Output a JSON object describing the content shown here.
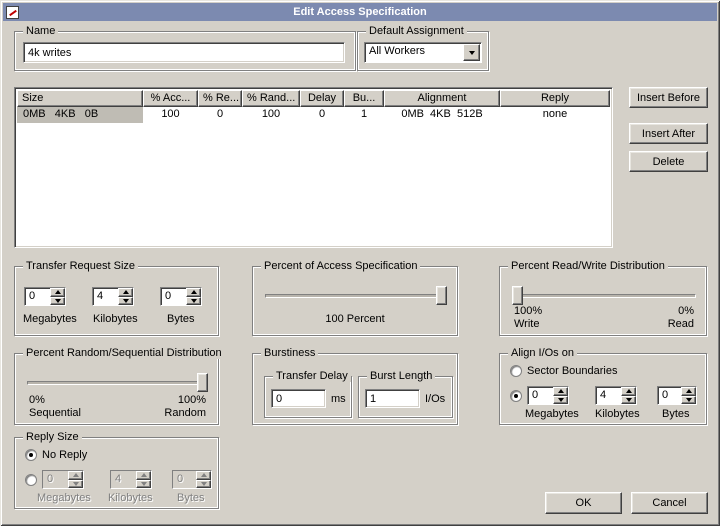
{
  "window": {
    "title": "Edit Access Specification"
  },
  "colors": {
    "titlebar": "#7c8ab0",
    "dialog_face": "#d4d0c8",
    "selected_cell": "#bfbcb4"
  },
  "name_group": {
    "label": "Name",
    "value": "4k writes"
  },
  "assignment_group": {
    "label": "Default Assignment",
    "value": "All Workers"
  },
  "spec_table": {
    "headers": [
      "Size",
      "% Acc...",
      "% Re...",
      "% Rand...",
      "Delay",
      "Bu...",
      "Alignment",
      "Reply"
    ],
    "row": {
      "size": "0MB   4KB   0B",
      "access": "100",
      "read": "0",
      "random": "100",
      "delay": "0",
      "burst": "1",
      "alignment": "0MB  4KB  512B",
      "reply": "none"
    }
  },
  "side_buttons": {
    "insert_before": "Insert Before",
    "insert_after": "Insert After",
    "delete": "Delete"
  },
  "transfer_request_size": {
    "label": "Transfer Request Size",
    "megabytes": "0",
    "kilobytes": "4",
    "bytes": "0",
    "megabytes_label": "Megabytes",
    "kilobytes_label": "Kilobytes",
    "bytes_label": "Bytes"
  },
  "percent_access_spec": {
    "label": "Percent of Access Specification",
    "value_label": "100 Percent"
  },
  "read_write_dist": {
    "label": "Percent Read/Write Distribution",
    "left_percent": "100%",
    "left_label": "Write",
    "right_percent": "0%",
    "right_label": "Read"
  },
  "random_seq_dist": {
    "label": "Percent Random/Sequential Distribution",
    "left_percent": "0%",
    "left_label": "Sequential",
    "right_percent": "100%",
    "right_label": "Random"
  },
  "burstiness": {
    "label": "Burstiness",
    "transfer_delay_label": "Transfer Delay",
    "transfer_delay_value": "0",
    "transfer_delay_unit": "ms",
    "burst_length_label": "Burst Length",
    "burst_length_value": "1",
    "burst_length_unit": "I/Os"
  },
  "align_ios": {
    "label": "Align I/Os on",
    "sector_option": "Sector Boundaries",
    "megabytes": "0",
    "kilobytes": "4",
    "bytes": "0",
    "megabytes_label": "Megabytes",
    "kilobytes_label": "Kilobytes",
    "bytes_label": "Bytes"
  },
  "reply_size": {
    "label": "Reply Size",
    "no_reply_option": "No Reply",
    "megabytes": "0",
    "kilobytes": "4",
    "bytes": "0",
    "megabytes_label": "Megabytes",
    "kilobytes_label": "Kilobytes",
    "bytes_label": "Bytes"
  },
  "footer": {
    "ok": "OK",
    "cancel": "Cancel"
  }
}
